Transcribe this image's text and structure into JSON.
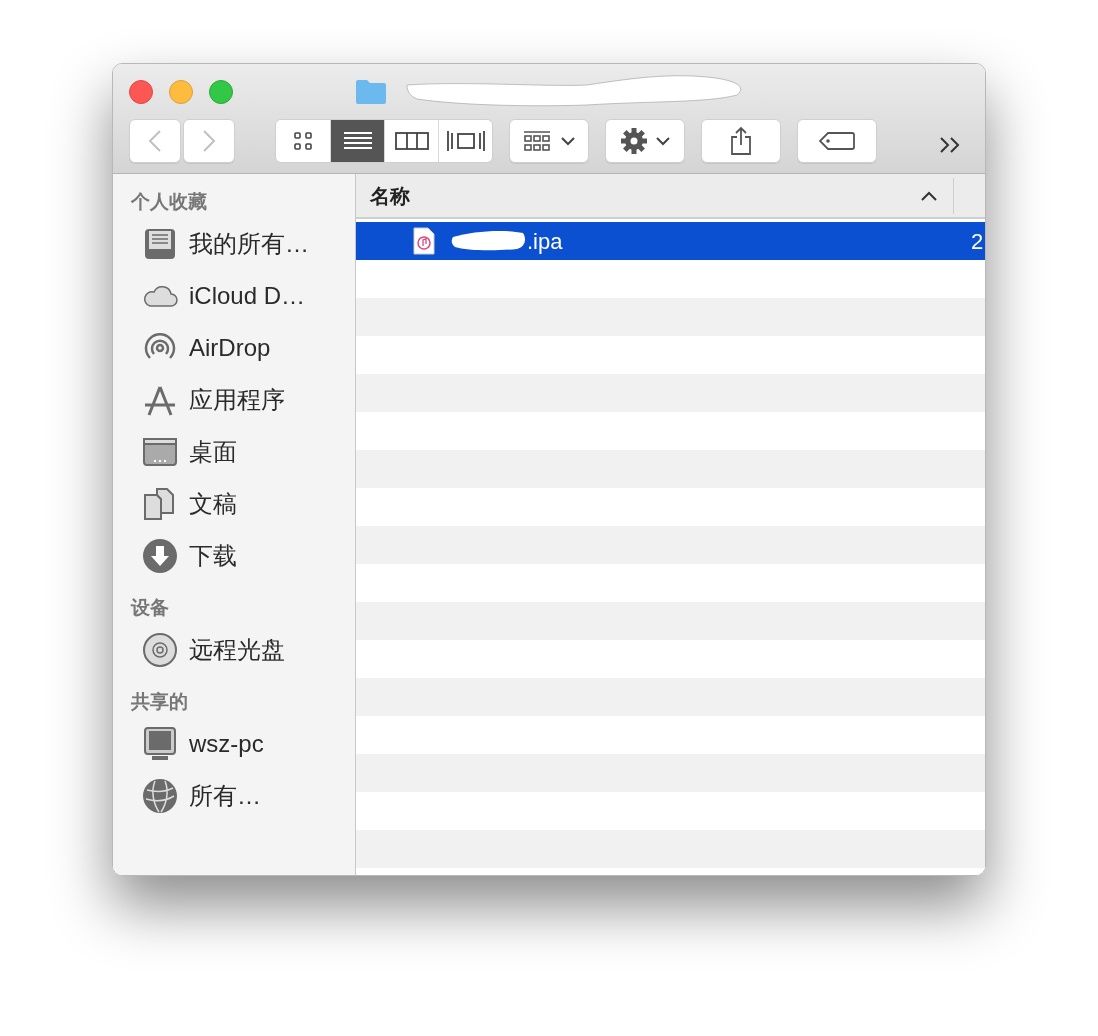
{
  "toolbar": {
    "view_modes": [
      {
        "selected": false
      },
      {
        "selected": true
      },
      {
        "selected": false
      },
      {
        "selected": false
      }
    ]
  },
  "sidebar": {
    "sections": [
      {
        "title": "个人收藏",
        "items": [
          {
            "label": "我的所有…",
            "kind": "recents"
          },
          {
            "label": "iCloud D…",
            "kind": "cloud"
          },
          {
            "label": "AirDrop",
            "kind": "airdrop"
          },
          {
            "label": "应用程序",
            "kind": "apps"
          },
          {
            "label": "桌面",
            "kind": "desktop"
          },
          {
            "label": "文稿",
            "kind": "documents"
          },
          {
            "label": "下载",
            "kind": "downloads"
          }
        ]
      },
      {
        "title": "设备",
        "items": [
          {
            "label": "远程光盘",
            "kind": "disc"
          }
        ]
      },
      {
        "title": "共享的",
        "items": [
          {
            "label": "wsz-pc",
            "kind": "computer"
          },
          {
            "label": "所有…",
            "kind": "network"
          }
        ]
      }
    ]
  },
  "table": {
    "columns": [
      "名称"
    ],
    "rows": [
      {
        "name": ".ipa",
        "column_2": "2",
        "selected": true
      }
    ]
  }
}
